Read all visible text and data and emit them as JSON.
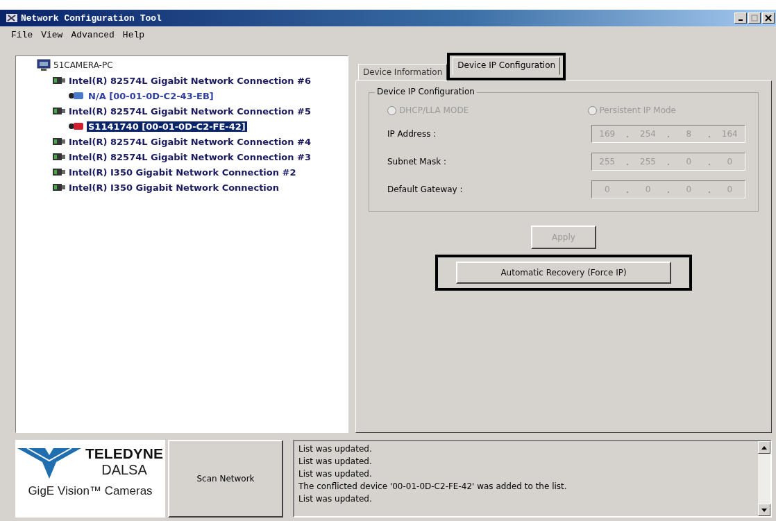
{
  "window": {
    "title": "Network Configuration Tool"
  },
  "menu": [
    "File",
    "View",
    "Advanced",
    "Help"
  ],
  "tree": {
    "label": "51CAMERA-PC",
    "children": [
      {
        "label": "Intel(R) 82574L Gigabit Network Connection #6",
        "children": [
          {
            "label": "N/A [00-01-0D-C2-43-EB]",
            "color": "#4a7ac8",
            "selected": false
          }
        ]
      },
      {
        "label": "Intel(R) 82574L Gigabit Network Connection #5",
        "children": [
          {
            "label": "S1141740 [00-01-0D-C2-FE-42]",
            "color": "#d02030",
            "selected": true
          }
        ]
      },
      {
        "label": "Intel(R) 82574L Gigabit Network Connection #4"
      },
      {
        "label": "Intel(R) 82574L Gigabit Network Connection #3"
      },
      {
        "label": "Intel(R) I350 Gigabit Network Connection #2"
      },
      {
        "label": "Intel(R) I350 Gigabit Network Connection"
      }
    ]
  },
  "tabs": [
    {
      "label": "Device Information",
      "selected": false,
      "highlighted": false
    },
    {
      "label": "Device IP Configuration",
      "selected": true,
      "highlighted": true
    }
  ],
  "group": {
    "title": "Device IP Configuration",
    "modes": [
      {
        "label": "DHCP/LLA MODE",
        "selected": false,
        "disabled": true
      },
      {
        "label": "Persistent IP Mode",
        "selected": false,
        "disabled": true
      }
    ],
    "fields": [
      {
        "label": "IP Address :",
        "octets": [
          "169",
          "254",
          "8",
          "164"
        ]
      },
      {
        "label": "Subnet Mask :",
        "octets": [
          "255",
          "255",
          "0",
          "0"
        ]
      },
      {
        "label": "Default Gateway :",
        "octets": [
          "0",
          "0",
          "0",
          "0"
        ]
      }
    ]
  },
  "buttons": [
    {
      "label": "Apply",
      "disabled": true,
      "highlighted": false
    },
    {
      "label": "Automatic Recovery (Force IP)",
      "disabled": false,
      "highlighted": true
    }
  ],
  "logo": {
    "name": "TELEDYNE",
    "sub": "DALSA",
    "tagline": "GigE Vision™ Cameras"
  },
  "scan_button": "Scan Network",
  "log": [
    "List was updated.",
    "List was updated.",
    "List was updated.",
    "The conflicted device '00-01-0D-C2-FE-42' was added to the list.",
    "List was updated."
  ]
}
